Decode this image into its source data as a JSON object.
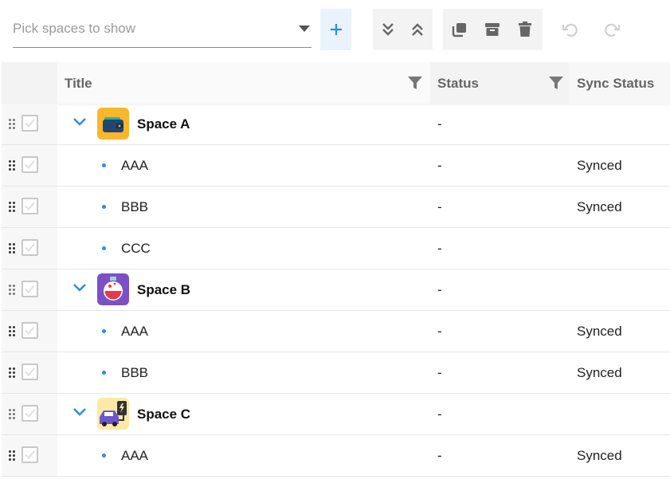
{
  "toolbar": {
    "picker_placeholder": "Pick spaces to show",
    "accent_color": "#2f8bdc"
  },
  "table": {
    "headers": {
      "title": "Title",
      "status": "Status",
      "sync_status": "Sync Status"
    },
    "rows": [
      {
        "type": "space",
        "name": "Space A",
        "status": "-",
        "sync": "",
        "icon": "wallet-icon"
      },
      {
        "type": "item",
        "name": "AAA",
        "status": "-",
        "sync": "Synced"
      },
      {
        "type": "item",
        "name": "BBB",
        "status": "-",
        "sync": "Synced"
      },
      {
        "type": "item",
        "name": "CCC",
        "status": "-",
        "sync": ""
      },
      {
        "type": "space",
        "name": "Space B",
        "status": "-",
        "sync": "",
        "icon": "potion-icon"
      },
      {
        "type": "item",
        "name": "AAA",
        "status": "-",
        "sync": "Synced"
      },
      {
        "type": "item",
        "name": "BBB",
        "status": "-",
        "sync": "Synced"
      },
      {
        "type": "space",
        "name": "Space C",
        "status": "-",
        "sync": "",
        "icon": "ev-car-charging-icon"
      },
      {
        "type": "item",
        "name": "AAA",
        "status": "-",
        "sync": "Synced"
      }
    ]
  }
}
